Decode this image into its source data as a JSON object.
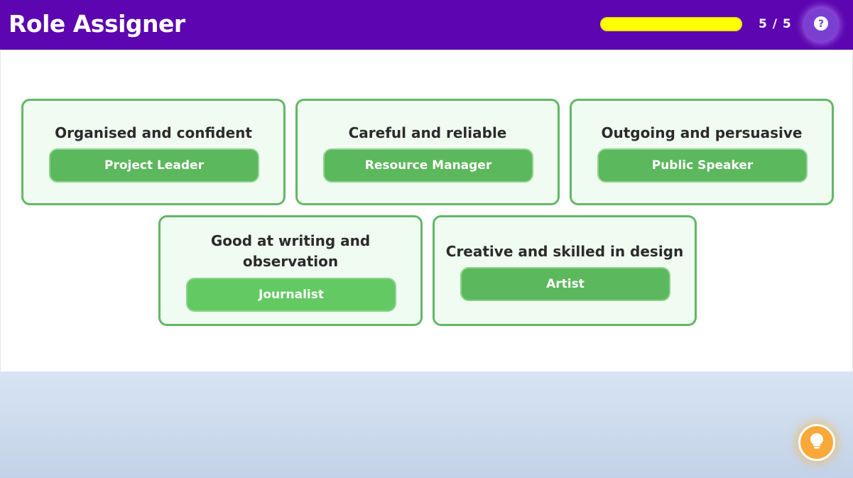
{
  "header": {
    "title": "Role Assigner",
    "progress_text": "5 / 5",
    "progress_fraction": 1.0,
    "progress_color": "#ffff00",
    "help_icon": "question-mark-icon"
  },
  "cards": [
    {
      "trait": "Organised and confident",
      "role": "Project Leader"
    },
    {
      "trait": "Careful and reliable",
      "role": "Resource Manager"
    },
    {
      "trait": "Outgoing and persuasive",
      "role": "Public Speaker"
    },
    {
      "trait": "Good at writing and observation",
      "role": "Journalist"
    },
    {
      "trait": "Creative and skilled in design",
      "role": "Artist"
    }
  ],
  "footer": {
    "hint_icon": "lightbulb-icon"
  },
  "colors": {
    "header_bg": "#5c05b0",
    "card_border": "#62b866",
    "card_bg": "#f0fbf1",
    "button_bg": "#5cb85c",
    "hint_bg": "#f9a93a"
  }
}
